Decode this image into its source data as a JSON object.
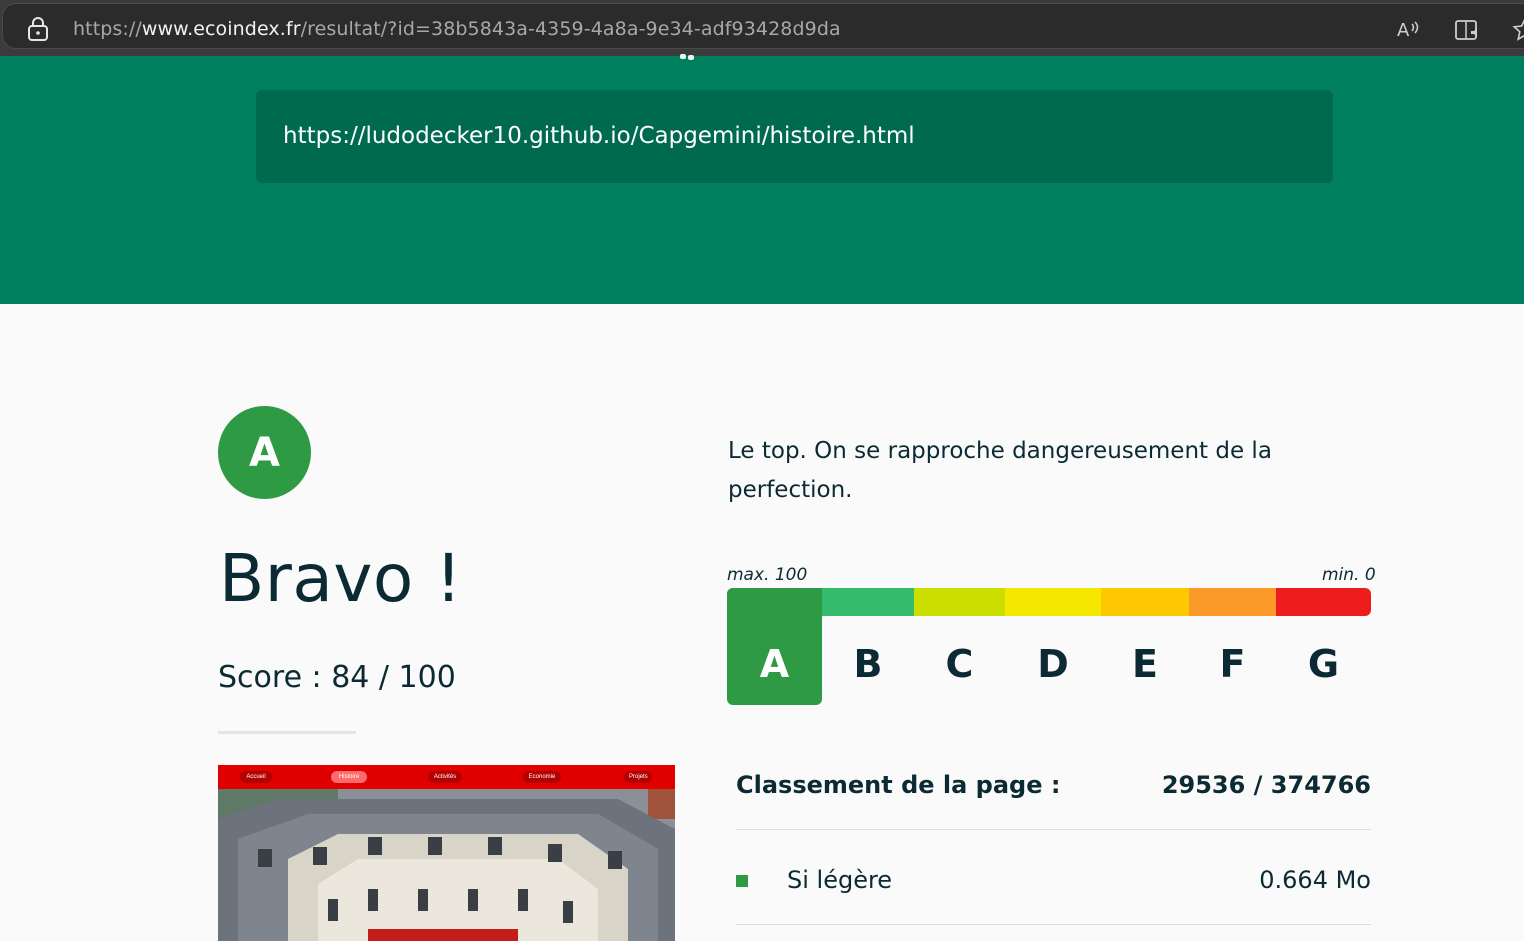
{
  "browser": {
    "url_prefix": "https://",
    "url_host": "www.ecoindex.fr",
    "url_path": "/resultat/?id=38b5843a-4359-4a8a-9e34-adf93428d9da",
    "icons": [
      "lock-icon",
      "read-aloud-icon",
      "immersive-reader-icon",
      "favorite-star-icon"
    ]
  },
  "hero": {
    "analyzed_url": "https://ludodecker10.github.io/Capgemini/histoire.html",
    "background_color": "#008060"
  },
  "result": {
    "grade": "A",
    "headline": "Bravo !",
    "score": "Score : 84 / 100",
    "message": "Le top. On se rapproche dangereusement de la perfection."
  },
  "scale": {
    "max_label": "max. 100",
    "min_label": "min. 0",
    "active": "A",
    "grades": [
      {
        "letter": "A",
        "color": "#2e9a44"
      },
      {
        "letter": "B",
        "color": "#34bb6b"
      },
      {
        "letter": "C",
        "color": "#cadf00"
      },
      {
        "letter": "D",
        "color": "#f6e700"
      },
      {
        "letter": "E",
        "color": "#fec800"
      },
      {
        "letter": "F",
        "color": "#fb9a29"
      },
      {
        "letter": "G",
        "color": "#ee1d1d"
      }
    ]
  },
  "stats": {
    "rank_label": "Classement de la page :",
    "rank_value": "29536 / 374766",
    "weight_label": "Si légère",
    "weight_value": "0.664 Mo"
  },
  "thumbnail": {
    "nav": [
      "Accueil",
      "Histoire",
      "Activités",
      "Economie",
      "Projets"
    ],
    "active_nav": "Histoire"
  }
}
